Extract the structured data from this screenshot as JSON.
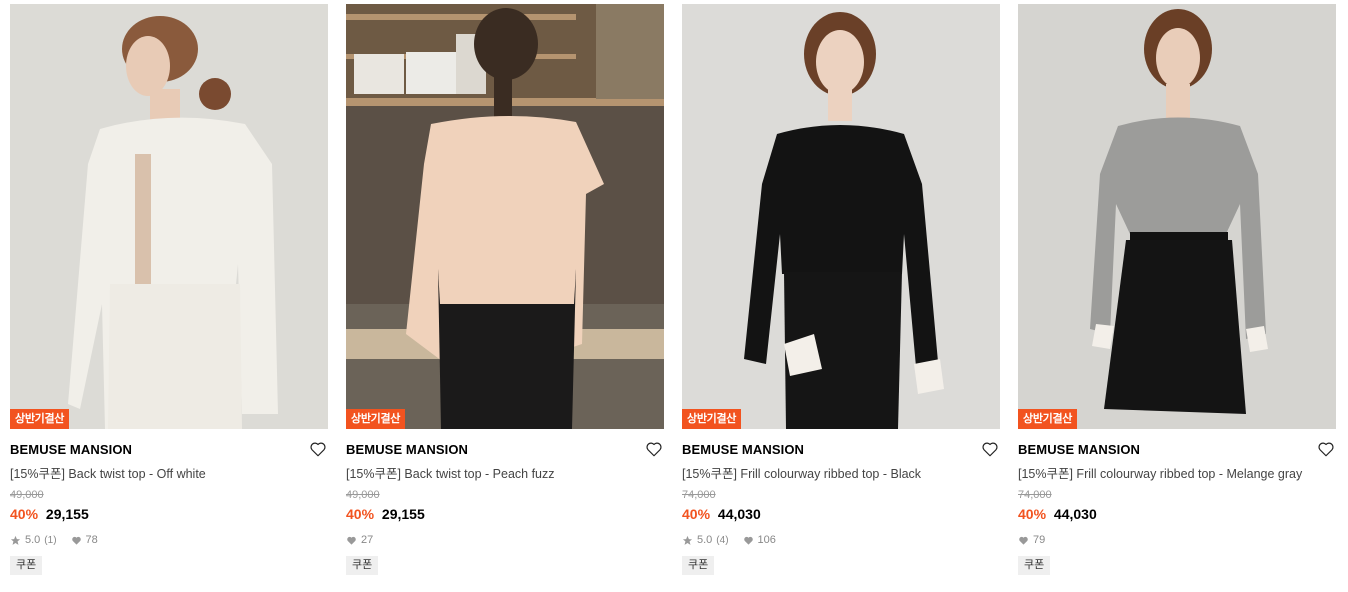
{
  "products": [
    {
      "badge": "상반기결산",
      "brand": "BEMUSE MANSION",
      "name": "[15%쿠폰] Back twist top - Off white",
      "original_price": "49,000",
      "discount": "40%",
      "price": "29,155",
      "rating": "5.0",
      "review_count": "(1)",
      "likes": "78",
      "coupon": "쿠폰",
      "colors": {
        "bg": "#dcdbd6",
        "garment": "#f1efe9",
        "bottom": "#eeebe4"
      }
    },
    {
      "badge": "상반기결산",
      "brand": "BEMUSE MANSION",
      "name": "[15%쿠폰] Back twist top - Peach fuzz",
      "original_price": "49,000",
      "discount": "40%",
      "price": "29,155",
      "rating": "",
      "review_count": "",
      "likes": "27",
      "coupon": "쿠폰",
      "colors": {
        "bg": "#5b5046",
        "garment": "#f0d2bb",
        "bottom": "#1b1a1a"
      }
    },
    {
      "badge": "상반기결산",
      "brand": "BEMUSE MANSION",
      "name": "[15%쿠폰] Frill colourway ribbed top - Black",
      "original_price": "74,000",
      "discount": "40%",
      "price": "44,030",
      "rating": "5.0",
      "review_count": "(4)",
      "likes": "106",
      "coupon": "쿠폰",
      "colors": {
        "bg": "#dcdbd8",
        "garment": "#131313",
        "bottom": "#151515"
      }
    },
    {
      "badge": "상반기결산",
      "brand": "BEMUSE MANSION",
      "name": "[15%쿠폰] Frill colourway ribbed top - Melange gray",
      "original_price": "74,000",
      "discount": "40%",
      "price": "44,030",
      "rating": "",
      "review_count": "",
      "likes": "79",
      "coupon": "쿠폰",
      "colors": {
        "bg": "#d5d4d0",
        "garment": "#9c9c9a",
        "bottom": "#141414"
      }
    }
  ],
  "accent_color": "#f2531f",
  "icons": {
    "wishlist": "heart-outline-icon",
    "rating": "star-icon",
    "likes": "heart-filled-icon"
  }
}
